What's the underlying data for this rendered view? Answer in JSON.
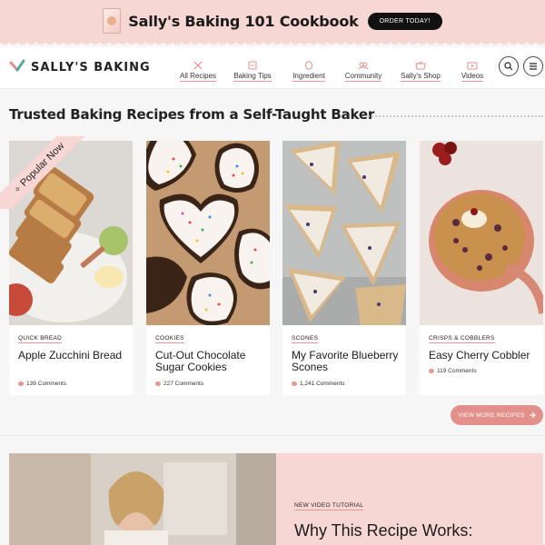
{
  "promo": {
    "title": "Sally's Baking 101 Cookbook",
    "button": "ORDER TODAY!",
    "background": "#f7d7d3"
  },
  "header": {
    "logo_text": "SALLY'S BAKING",
    "nav": [
      {
        "label": "All Recipes",
        "icon": "whisk-icon"
      },
      {
        "label": "Baking Tips",
        "icon": "tips-icon"
      },
      {
        "label": "Ingredient",
        "icon": "egg-icon"
      },
      {
        "label": "Community",
        "icon": "community-icon"
      },
      {
        "label": "Sally's Shop",
        "icon": "shop-icon"
      },
      {
        "label": "Videos",
        "icon": "video-icon"
      }
    ]
  },
  "section": {
    "title": "Trusted Baking Recipes from a Self-Taught Baker",
    "ribbon": "Popular Now"
  },
  "cards": [
    {
      "category": "QUICK BREAD",
      "title": "Apple Zucchini Bread",
      "comments": "139 Comments"
    },
    {
      "category": "COOKIES",
      "title": "Cut-Out Chocolate Sugar Cookies",
      "comments": "227 Comments"
    },
    {
      "category": "SCONES",
      "title": "My Favorite Blueberry Scones",
      "comments": "1,241 Comments"
    },
    {
      "category": "CRISPS & COBBLERS",
      "title": "Easy Cherry Cobbler",
      "comments": "119 Comments"
    }
  ],
  "view_more": "VIEW MORE RECIPES",
  "feature": {
    "tag": "NEW VIDEO TUTORIAL",
    "title": "Why This Recipe Works:"
  },
  "colors": {
    "accent": "#e4908a",
    "pink_bg": "#f7d7d3"
  }
}
